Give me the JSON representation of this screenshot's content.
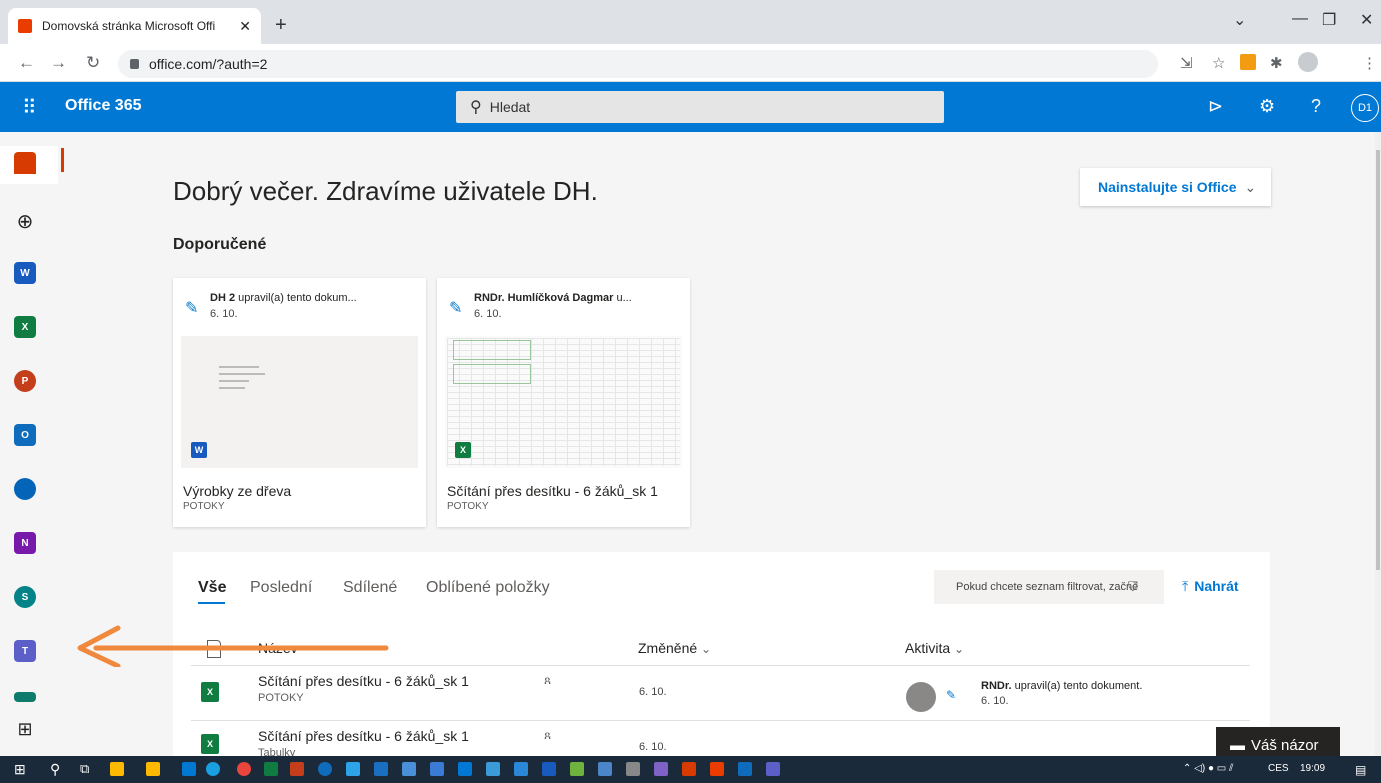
{
  "browser": {
    "tab_title": "Domovská stránka Microsoft Offi",
    "tab_close": "✕",
    "new_tab": "+",
    "url": "office.com/?auth=2"
  },
  "header": {
    "brand": "Office 365",
    "search_placeholder": "Hledat",
    "avatar_initials": "D1",
    "help": "?"
  },
  "main": {
    "greeting": "Dobrý večer. Zdravíme uživatele DH.",
    "install_label": "Nainstalujte si Office",
    "recommended_title": "Doporučené",
    "cards": [
      {
        "who": "DH 2",
        "action": " upravil(a) tento dokum...",
        "date": "6. 10.",
        "name": "Výrobky ze dřeva",
        "location": "POTOKY",
        "app": "W"
      },
      {
        "who": "RNDr. Humlíčková Dagmar",
        "action": " u...",
        "date": "6. 10.",
        "name": "Sčítání přes desítku - 6 žáků_sk 1",
        "location": "POTOKY",
        "app": "X"
      }
    ]
  },
  "files": {
    "tabs": [
      "Vše",
      "Poslední",
      "Sdílené",
      "Oblíbené položky"
    ],
    "filter_placeholder": "Pokud chcete seznam filtrovat, začně",
    "upload_label": "Nahrát",
    "columns": {
      "name": "Název",
      "modified": "Změněné",
      "activity": "Aktivita"
    },
    "rows": [
      {
        "name": "Sčítání přes desítku - 6 žáků_sk 1",
        "location": "POTOKY",
        "modified": "6. 10.",
        "activity_who": "RNDr.",
        "activity_text": " upravil(a) tento dokument.",
        "activity_date": "6. 10."
      },
      {
        "name": "Sčítání přes desítku - 6 žáků_sk 1",
        "location": "Tabulky",
        "modified": "6. 10."
      }
    ]
  },
  "feedback_label": "Váš názor",
  "taskbar": {
    "language": "CES",
    "time": "19:09"
  },
  "colors": {
    "office_blue": "#0078d4",
    "accent_orange": "#d83b01",
    "arrow": "#f0883e"
  }
}
